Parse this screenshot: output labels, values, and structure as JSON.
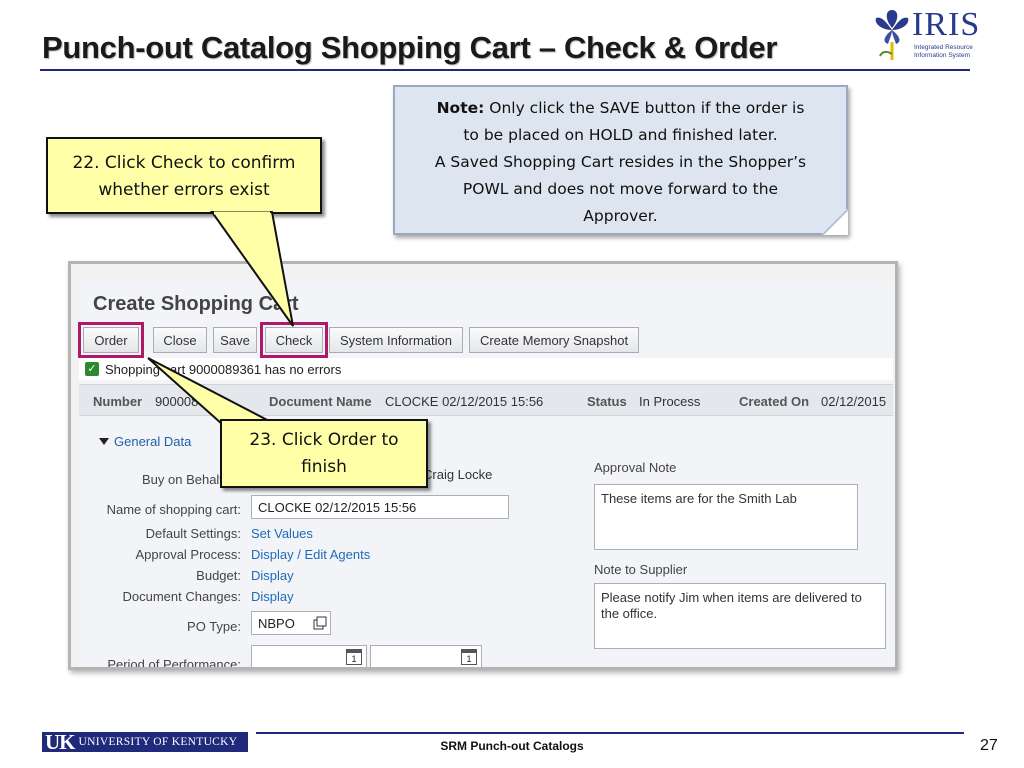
{
  "slide": {
    "title": "Punch-out Catalog Shopping Cart – Check & Order",
    "footer_text": "SRM Punch-out Catalogs",
    "page_number": "27"
  },
  "logo": {
    "word": "IRIS",
    "line1": "Integrated Resource",
    "line2": "Information System",
    "footer_uk": "UK",
    "footer_university": "UNIVERSITY OF KENTUCKY"
  },
  "note": {
    "label": "Note:",
    "line1": " Only click the SAVE button if the order is",
    "line2": "to be placed on HOLD and finished later.",
    "line3": "A Saved Shopping Cart resides in the Shopper’s",
    "line4": "POWL and does not move forward to the",
    "line5": "Approver."
  },
  "callouts": {
    "check_line1": "22. Click Check to confirm",
    "check_line2": "whether errors exist",
    "order_line1": "23. Click Order to",
    "order_line2": "finish"
  },
  "sap": {
    "heading": "Create Shopping Cart",
    "toolbar": {
      "order": "Order",
      "close": "Close",
      "save": "Save",
      "check": "Check",
      "system_info": "System Information",
      "memory_snapshot": "Create Memory Snapshot"
    },
    "message": "Shopping cart 9000089361 has no errors",
    "header": {
      "number_label": "Number",
      "number_value": "9000089361",
      "docname_label": "Document Name",
      "docname_value": "CLOCKE 02/12/2015 15:56",
      "status_label": "Status",
      "status_value": "In Process",
      "created_label": "Created On",
      "created_value": "02/12/2015"
    },
    "section_title": "General Data",
    "form": {
      "buy_on_behalf_label": "Buy on Behalf of:",
      "buy_on_behalf_value": "Craig Locke",
      "name_label": "Name of shopping cart:",
      "name_value": "CLOCKE 02/12/2015 15:56",
      "default_settings_label": "Default Settings:",
      "default_settings_link": "Set Values",
      "approval_process_label": "Approval Process:",
      "approval_process_link": "Display / Edit Agents",
      "budget_label": "Budget:",
      "budget_link": "Display",
      "doc_changes_label": "Document Changes:",
      "doc_changes_link": "Display",
      "po_type_label": "PO Type:",
      "po_type_value": "NBPO",
      "period_label": "Period of Performance:"
    },
    "approval_note_label": "Approval Note",
    "approval_note_text": "These items are for the Smith Lab",
    "supplier_note_label": "Note to Supplier",
    "supplier_note_text": "Please notify Jim when items are delivered to the office."
  },
  "colors": {
    "callout_fill": "#ffffa8",
    "highlight_border": "#b0186a",
    "title_rule": "#1f2a7a",
    "link": "#1f6bb8",
    "success": "#2b8a2b"
  },
  "icons": [
    "iris-flower-icon",
    "success-check-icon",
    "collapse-triangle-icon",
    "value-help-icon",
    "calendar-icon"
  ]
}
